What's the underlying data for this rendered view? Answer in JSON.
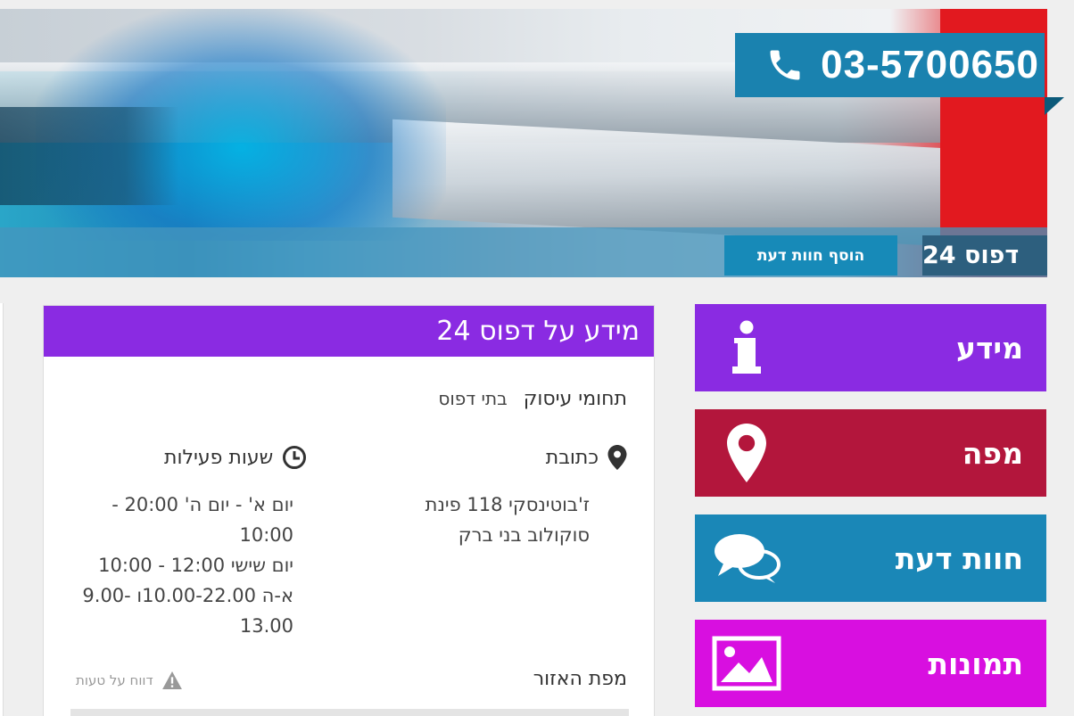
{
  "header": {
    "phone": "03-5700650",
    "business_name": "דפוס 24",
    "add_review_label": "הוסף חוות דעת"
  },
  "panel": {
    "title": "מידע על דפוס 24",
    "business_fields_label": "תחומי עיסוק",
    "business_fields_value": "בתי דפוס",
    "address_label": "כתובת",
    "address_lines": [
      "ז'בוטינסקי 118 פינת",
      "סוקולוב בני ברק"
    ],
    "hours_label": "שעות פעילות",
    "hours_lines": [
      "יום א' - יום ה' 20:00 -",
      "10:00",
      "יום שישי 12:00 - 10:00",
      "א-ה 10.00-22.00ו -9.00",
      "13.00"
    ],
    "map_label": "מפת האזור",
    "report_label": "דווח על טעות"
  },
  "nav": {
    "info": "מידע",
    "map": "מפה",
    "reviews": "חוות דעת",
    "photos": "תמונות"
  },
  "colors": {
    "purple": "#8a2be2",
    "crimson": "#b3163c",
    "blue": "#1a87b7",
    "magenta": "#d80fe0",
    "phone_bg": "#1a82af"
  },
  "icons": {
    "phone": "phone-icon",
    "info": "info-icon",
    "map": "map-pin-icon",
    "reviews": "speech-bubbles-icon",
    "photos": "image-icon",
    "address": "location-pin-icon",
    "hours": "clock-icon",
    "report": "warning-icon"
  }
}
